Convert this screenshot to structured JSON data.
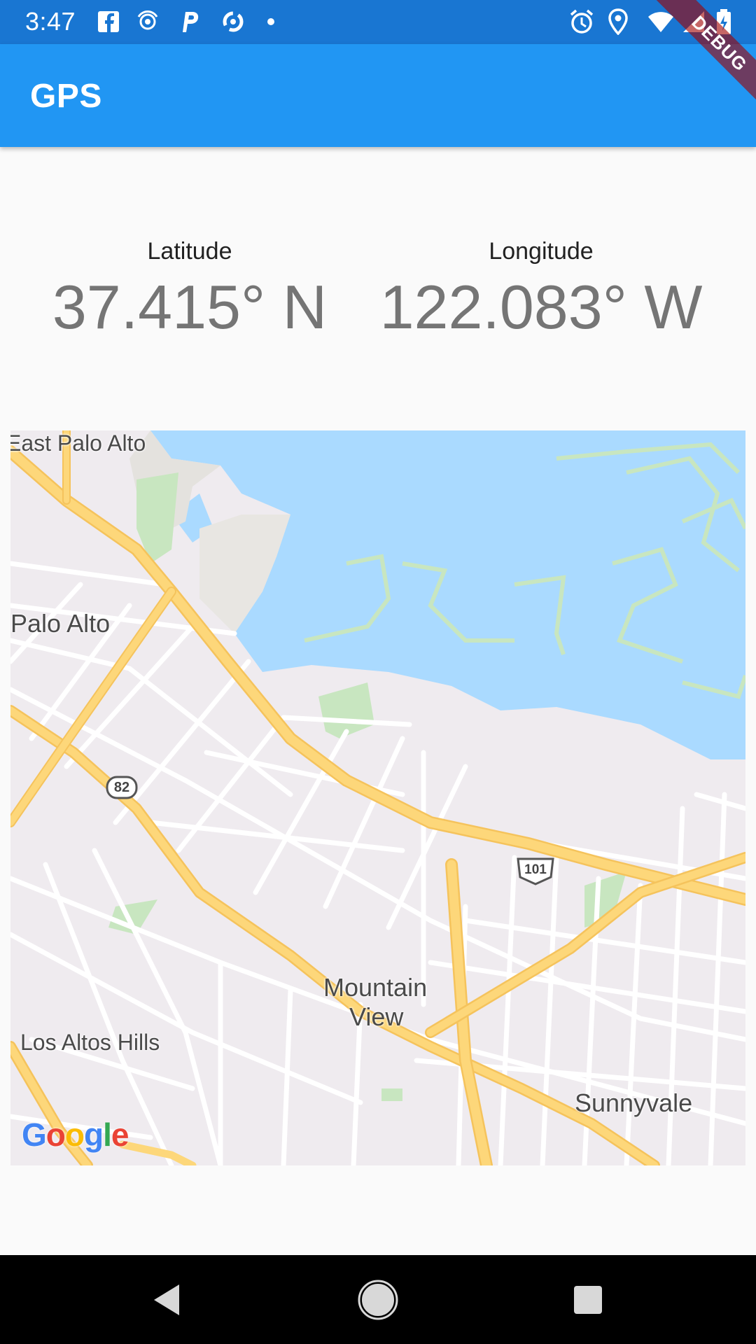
{
  "status_bar": {
    "time": "3:47",
    "left_icons": [
      "facebook-icon",
      "hotspot-icon",
      "p-icon",
      "sync-icon",
      "dot-icon"
    ],
    "right_icons": [
      "alarm-icon",
      "location-icon",
      "wifi-icon",
      "signal-icon",
      "battery-icon"
    ]
  },
  "app_bar": {
    "title": "GPS",
    "debug_banner": "DEBUG"
  },
  "coordinates": {
    "latitude_label": "Latitude",
    "latitude_value": "37.415° N",
    "longitude_label": "Longitude",
    "longitude_value": "122.083° W"
  },
  "map": {
    "labels": {
      "east_palo_alto": "East Palo Alto",
      "palo_alto": "Palo Alto",
      "mountain_view_line1": "Mountain",
      "mountain_view_line2": "View",
      "los_altos_hills": "Los Altos Hills",
      "sunnyvale": "Sunnyvale"
    },
    "shields": {
      "route_82": "82",
      "route_101": "101"
    },
    "attribution": "Google",
    "colors": {
      "land": "#efebef",
      "water": "#aadaff",
      "park": "#c8e6c0",
      "highway": "#fdd77a",
      "road": "#ffffff"
    }
  },
  "nav_bar": {
    "buttons": [
      "back-icon",
      "home-icon",
      "recents-icon"
    ]
  }
}
